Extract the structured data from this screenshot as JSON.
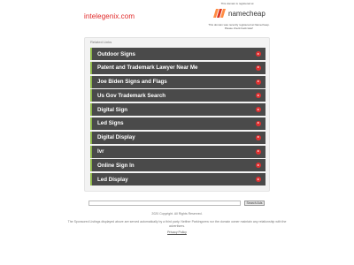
{
  "header": {
    "domain": "intelegenix.com",
    "notice_top": "This domain is registered at",
    "registrar_logo": "namecheap",
    "notice_bottom": "This domain was recently registered at Namecheap. Please check back later!"
  },
  "related": {
    "label": "Related Links",
    "accent": "#8fb84a",
    "arrow_color": "#e03131",
    "items": [
      {
        "label": "Outdoor Signs"
      },
      {
        "label": "Patent and Trademark Lawyer Near Me"
      },
      {
        "label": "Joe Biden Signs and Flags"
      },
      {
        "label": "Us Gov Trademark Search"
      },
      {
        "label": "Digital Sign"
      },
      {
        "label": "Led Signs"
      },
      {
        "label": "Digital Display"
      },
      {
        "label": "Ivr"
      },
      {
        "label": "Online Sign In"
      },
      {
        "label": "Led Display"
      }
    ]
  },
  "search": {
    "placeholder": "",
    "button_label": "Search Ads"
  },
  "footer": {
    "copyright": "2020 Copyright. All Rights Reserved.",
    "disclaimer": "The Sponsored Listings displayed above are served automatically by a third party. Neither Parkingcrew nor the domain owner maintain any relationship with the advertisers.",
    "privacy_label": "Privacy Policy"
  }
}
